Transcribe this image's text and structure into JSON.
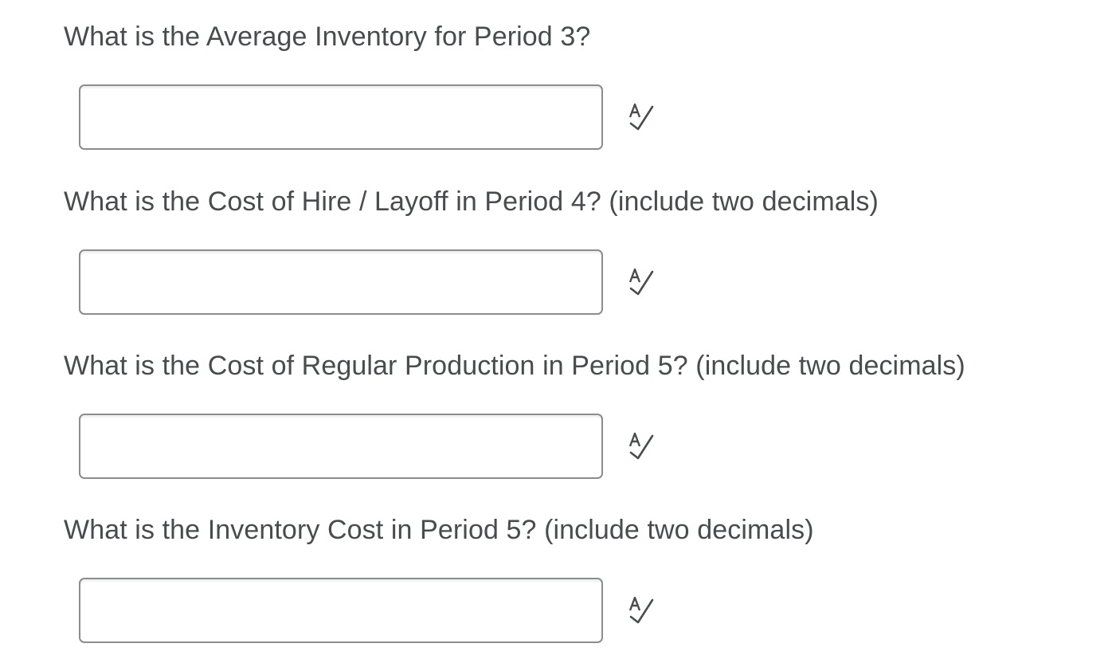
{
  "questions": [
    {
      "text": "What is the Average Inventory for Period 3?",
      "answer_value": "",
      "answer_placeholder": "",
      "spellcheck_icon": "spellcheck-icon"
    },
    {
      "text": "What is the Cost of Hire / Layoff in Period 4? (include two decimals)",
      "answer_value": "",
      "answer_placeholder": "",
      "spellcheck_icon": "spellcheck-icon"
    },
    {
      "text": "What is the Cost of Regular Production in Period 5? (include two decimals)",
      "answer_value": "",
      "answer_placeholder": "",
      "spellcheck_icon": "spellcheck-icon"
    },
    {
      "text": "What is the Inventory Cost in Period 5? (include two decimals)",
      "answer_value": "",
      "answer_placeholder": "",
      "spellcheck_icon": "spellcheck-icon"
    }
  ],
  "colors": {
    "text": "#494c4e",
    "input_border": "#8a8c8e",
    "icon": "#494c4e"
  }
}
